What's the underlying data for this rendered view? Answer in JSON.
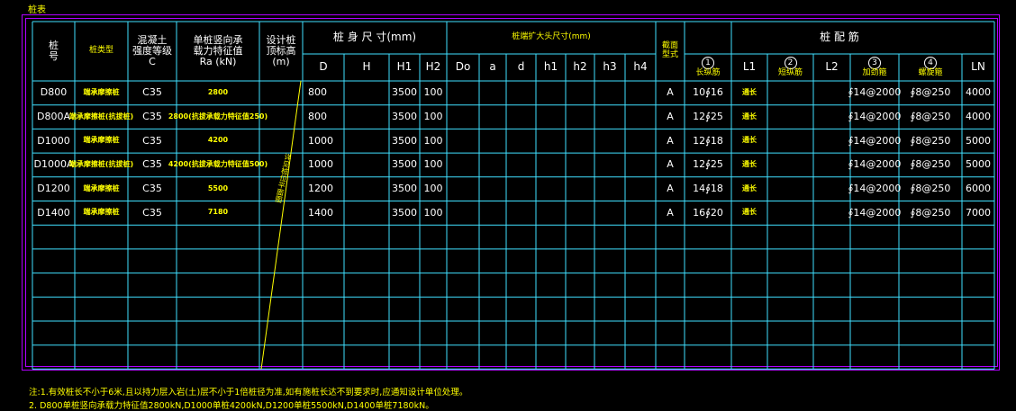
{
  "title": "桩表",
  "headers": {
    "pile_no": [
      "桩",
      "号"
    ],
    "pile_type": "桩类型",
    "concrete": [
      "混凝土",
      "强度等级",
      "C"
    ],
    "capacity": [
      "单桩竖向承",
      "载力特征值",
      "Ra (kN)"
    ],
    "elev": [
      "设计桩",
      "顶标高",
      "(m)"
    ],
    "body_size": "桩 身 尺 寸(mm)",
    "end_size": "桩端扩大头尺寸(mm)",
    "section": [
      "截面",
      "型式"
    ],
    "rebar": "桩 配 筋",
    "D": "D",
    "H": "H",
    "H1": "H1",
    "H2": "H2",
    "Do": "Do",
    "a": "a",
    "d": "d",
    "h1": "h1",
    "h2": "h2",
    "h3": "h3",
    "h4": "h4",
    "c1": "1",
    "c1_label": "长纵筋",
    "L1": "L1",
    "c2": "2",
    "c2_label": "短纵筋",
    "L2": "L2",
    "c3": "3",
    "c3_label": "加劲箍",
    "c4": "4",
    "c4_label": "螺旋箍",
    "LN": "LN"
  },
  "elev_note": "详见桩位平面图",
  "rows": [
    {
      "no": "D800",
      "type": "端承摩擦桩",
      "c": "C35",
      "ra": "2800",
      "D": "800",
      "H1": "3500",
      "H2": "100",
      "sec": "A",
      "r1": "10∮16",
      "l1": "通长",
      "r3": "∮14@2000",
      "r4": "∮8@250",
      "ln": "4000"
    },
    {
      "no": "D800A",
      "type": "端承摩擦桩(抗拔桩)",
      "c": "C35",
      "ra": "2800(抗拔承载力特征值250)",
      "D": "800",
      "H1": "3500",
      "H2": "100",
      "sec": "A",
      "r1": "12∮25",
      "l1": "通长",
      "r3": "∮14@2000",
      "r4": "∮8@250",
      "ln": "4000"
    },
    {
      "no": "D1000",
      "type": "端承摩擦桩",
      "c": "C35",
      "ra": "4200",
      "D": "1000",
      "H1": "3500",
      "H2": "100",
      "sec": "A",
      "r1": "12∮18",
      "l1": "通长",
      "r3": "∮14@2000",
      "r4": "∮8@250",
      "ln": "5000"
    },
    {
      "no": "D1000A",
      "type": "端承摩擦桩(抗拔桩)",
      "c": "C35",
      "ra": "4200(抗拔承载力特征值500)",
      "D": "1000",
      "H1": "3500",
      "H2": "100",
      "sec": "A",
      "r1": "12∮25",
      "l1": "通长",
      "r3": "∮14@2000",
      "r4": "∮8@250",
      "ln": "5000"
    },
    {
      "no": "D1200",
      "type": "端承摩擦桩",
      "c": "C35",
      "ra": "5500",
      "D": "1200",
      "H1": "3500",
      "H2": "100",
      "sec": "A",
      "r1": "14∮18",
      "l1": "通长",
      "r3": "∮14@2000",
      "r4": "∮8@250",
      "ln": "6000"
    },
    {
      "no": "D1400",
      "type": "端承摩擦桩",
      "c": "C35",
      "ra": "7180",
      "D": "1400",
      "H1": "3500",
      "H2": "100",
      "sec": "A",
      "r1": "16∮20",
      "l1": "通长",
      "r3": "∮14@2000",
      "r4": "∮8@250",
      "ln": "7000"
    }
  ],
  "notes": [
    "注:1.有效桩长不小于6米,且以持力层入岩(土)层不小于1倍桩径为准,如有施桩长达不到要求时,应通知设计单位处理。",
    "2. D800单桩竖向承载力特征值2800kN,D1000单桩4200kN,D1200单桩5500kN,D1400单桩7180kN。"
  ]
}
